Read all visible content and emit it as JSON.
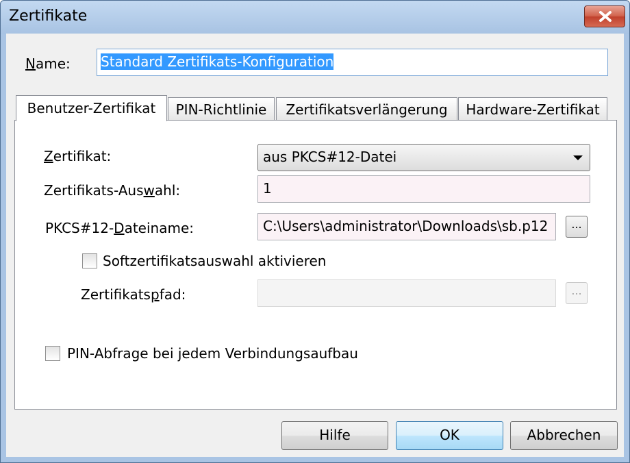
{
  "window": {
    "title": "Zertifikate"
  },
  "name": {
    "label_pre": "",
    "label_mn": "N",
    "label_post": "ame:",
    "value": "Standard Zertifikats-Konfiguration"
  },
  "tabs": [
    {
      "label": "Benutzer-Zertifikat",
      "active": true
    },
    {
      "label": "PIN-Richtlinie",
      "active": false
    },
    {
      "label": "Zertifikatsverlängerung",
      "active": false
    },
    {
      "label": "Hardware-Zertifikat",
      "active": false
    }
  ],
  "form": {
    "zertifikat": {
      "label_pre": "",
      "label_mn": "Z",
      "label_post": "ertifikat:",
      "value": "aus PKCS#12-Datei"
    },
    "auswahl": {
      "label_pre": "Zertifikats-Aus",
      "label_mn": "w",
      "label_post": "ahl:",
      "value": "1"
    },
    "dateiname": {
      "label_pre": "PKCS#12-",
      "label_mn": "D",
      "label_post": "ateiname:",
      "value": "C:\\Users\\administrator\\Downloads\\sb.p12",
      "browse_label": "..."
    },
    "soft_checkbox": {
      "label": "Softzertifikatsauswahl aktivieren",
      "checked": false
    },
    "pfad": {
      "label_pre": "Zertifikats",
      "label_mn": "p",
      "label_post": "fad:",
      "value": "",
      "browse_label": "..."
    },
    "pin_checkbox": {
      "label": "PIN-Abfrage bei jedem Verbindungsaufbau",
      "checked": false
    }
  },
  "buttons": {
    "help": "Hilfe",
    "ok": "OK",
    "cancel": "Abbrechen"
  },
  "icons": {
    "close": "close-icon",
    "dropdown": "chevron-down-icon"
  },
  "colors": {
    "titlebar": "#a9c4e4",
    "selection": "#3399ff",
    "close": "#c0402c"
  }
}
